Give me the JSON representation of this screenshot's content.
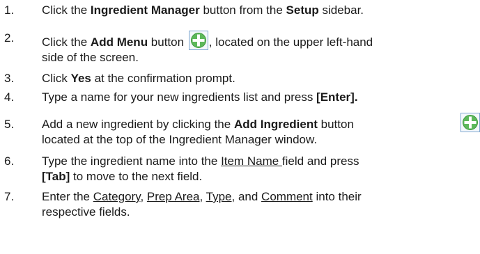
{
  "steps": [
    {
      "number": "1.",
      "parts": [
        "Click the ",
        "Ingredient Manager",
        " button from the ",
        "Setup",
        " sidebar."
      ]
    },
    {
      "number": "2.",
      "parts": [
        "Click the ",
        "Add Menu",
        " button ",
        ", located on the upper left-hand",
        "side of the screen."
      ]
    },
    {
      "number": "3.",
      "parts": [
        "Click ",
        "Yes",
        " at the confirmation prompt."
      ]
    },
    {
      "number": "4.",
      "parts": [
        "Type a name for your new ingredients list and press ",
        "[Enter]."
      ]
    },
    {
      "number": "5.",
      "parts": [
        "Add a new ingredient by clicking the ",
        "Add Ingredient",
        " button",
        "located at the top of the Ingredient Manager window."
      ]
    },
    {
      "number": "6.",
      "parts": [
        "Type the ingredient name into the ",
        "Item Name ",
        "field and press",
        "[Tab]",
        " to move to the next field."
      ]
    },
    {
      "number": "7.",
      "parts": [
        "Enter the ",
        "Category",
        ", ",
        "Prep Area",
        ", ",
        "Type",
        ", and ",
        "Comment",
        " into their",
        "respective fields."
      ]
    }
  ],
  "icons": {
    "add_button": {
      "name": "plus-circle-icon",
      "fill": "#5db85b",
      "border": "#7fa7cf",
      "frame_bg": "#f4f8fc"
    }
  }
}
